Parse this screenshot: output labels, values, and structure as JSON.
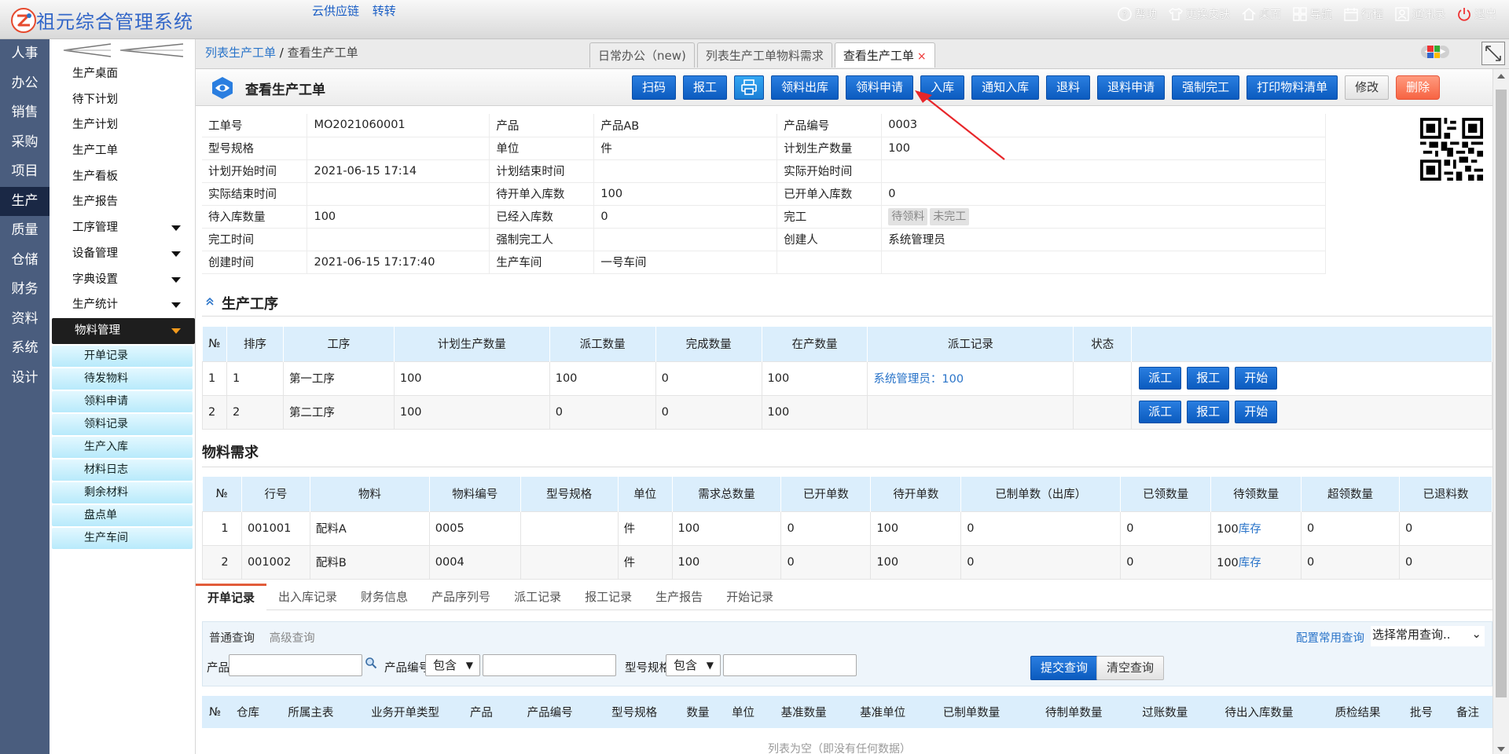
{
  "app": {
    "title": "祖元综合管理系统",
    "links": [
      "云供应链",
      "转转"
    ]
  },
  "topnav": [
    {
      "label": "帮助",
      "icon": "help-icon"
    },
    {
      "label": "更换皮肤",
      "icon": "shirt-icon"
    },
    {
      "label": "桌面",
      "icon": "home-icon"
    },
    {
      "label": "导航",
      "icon": "grid-icon"
    },
    {
      "label": "行程",
      "icon": "calendar-icon"
    },
    {
      "label": "通讯录",
      "icon": "contact-icon"
    },
    {
      "label": "退出",
      "icon": "power-icon"
    }
  ],
  "modules": [
    "人事",
    "办公",
    "销售",
    "采购",
    "项目",
    "生产",
    "质量",
    "仓储",
    "财务",
    "资料",
    "系统",
    "设计"
  ],
  "active_module": "生产",
  "submenu": {
    "items": [
      "生产桌面",
      "待下计划",
      "生产计划",
      "生产工单",
      "生产看板",
      "生产报告"
    ],
    "groups": [
      "工序管理",
      "设备管理",
      "字典设置",
      "生产统计"
    ],
    "opened_group": "物料管理",
    "sub_items": [
      "开单记录",
      "待发物料",
      "领料申请",
      "领料记录",
      "生产入库",
      "材料日志",
      "剩余材料",
      "盘点单",
      "生产车间"
    ]
  },
  "breadcrumb": {
    "link": "列表生产工单",
    "sep": " / ",
    "current": "查看生产工单"
  },
  "tabs": [
    {
      "label": "日常办公（new)"
    },
    {
      "label": "列表生产工单物料需求"
    },
    {
      "label": "查看生产工单",
      "close": "×"
    }
  ],
  "page": {
    "title": "查看生产工单",
    "actions": [
      "扫码",
      "报工",
      "领料出库",
      "领料申请",
      "入库",
      "通知入库",
      "退料",
      "退料申请",
      "强制完工",
      "打印物料清单"
    ],
    "edit": "修改",
    "delete": "删除"
  },
  "info": [
    [
      "工单号",
      "MO2021060001",
      "产品",
      "产品AB",
      "产品编号",
      "0003"
    ],
    [
      "型号规格",
      "",
      "单位",
      "件",
      "计划生产数量",
      "100"
    ],
    [
      "计划开始时间",
      "2021-06-15 17:14",
      "计划结束时间",
      "",
      "实际开始时间",
      ""
    ],
    [
      "实际结束时间",
      "",
      "待开单入库数",
      "100",
      "已开单入库数",
      "0"
    ],
    [
      "待入库数量",
      "100",
      "已经入库数",
      "0",
      "完工",
      ""
    ],
    [
      "完工时间",
      "",
      "强制完工人",
      "",
      "创建人",
      "系统管理员"
    ],
    [
      "创建时间",
      "2021-06-15 17:17:40",
      "生产车间",
      "一号车间",
      "",
      ""
    ]
  ],
  "status_tags": [
    "待领料",
    "未完工"
  ],
  "process": {
    "title": "生产工序",
    "headers": [
      "№",
      "排序",
      "工序",
      "计划生产数量",
      "派工数量",
      "完成数量",
      "在产数量",
      "派工记录",
      "状态",
      ""
    ],
    "rows": [
      {
        "no": "1",
        "order": "1",
        "name": "第一工序",
        "plan": "100",
        "dispatch": "100",
        "done": "0",
        "wip": "100",
        "record": "系统管理员：100",
        "status": ""
      },
      {
        "no": "2",
        "order": "2",
        "name": "第二工序",
        "plan": "100",
        "dispatch": "0",
        "done": "0",
        "wip": "100",
        "record": "",
        "status": ""
      }
    ],
    "row_buttons": [
      "派工",
      "报工",
      "开始"
    ]
  },
  "materials": {
    "title": "物料需求",
    "headers": [
      "№",
      "行号",
      "物料",
      "物料编号",
      "型号规格",
      "单位",
      "需求总数量",
      "已开单数",
      "待开单数",
      "已制单数（出库）",
      "已领数量",
      "待领数量",
      "超领数量",
      "已退料数"
    ],
    "rows": [
      [
        "1",
        "001001",
        "配料A",
        "0005",
        "",
        "件",
        "100",
        "0",
        "100",
        "0",
        "0",
        "100",
        "0",
        "0"
      ],
      [
        "2",
        "001002",
        "配料B",
        "0004",
        "",
        "件",
        "100",
        "0",
        "100",
        "0",
        "0",
        "100",
        "0",
        "0"
      ]
    ],
    "stock_link": "库存"
  },
  "bottom_tabs": [
    "开单记录",
    "出入库记录",
    "财务信息",
    "产品序列号",
    "派工记录",
    "报工记录",
    "生产报告",
    "开始记录"
  ],
  "query": {
    "tabs": [
      "普通查询",
      "高级查询"
    ],
    "config": "配置常用查询",
    "preset": "选择常用查询..",
    "product_label": "产品",
    "code_label": "产品编号",
    "spec_label": "型号规格",
    "op": "包含",
    "submit": "提交查询",
    "clear": "清空查询"
  },
  "bottom_table": {
    "headers": [
      "№",
      "仓库",
      "所属主表",
      "业务开单类型",
      "产品",
      "产品编号",
      "型号规格",
      "数量",
      "单位",
      "基准数量",
      "基准单位",
      "已制单数量",
      "待制单数量",
      "过账数量",
      "待出入库数量",
      "质检结果",
      "批号",
      "备注"
    ],
    "empty": "列表为空（即没有任何数据）"
  }
}
